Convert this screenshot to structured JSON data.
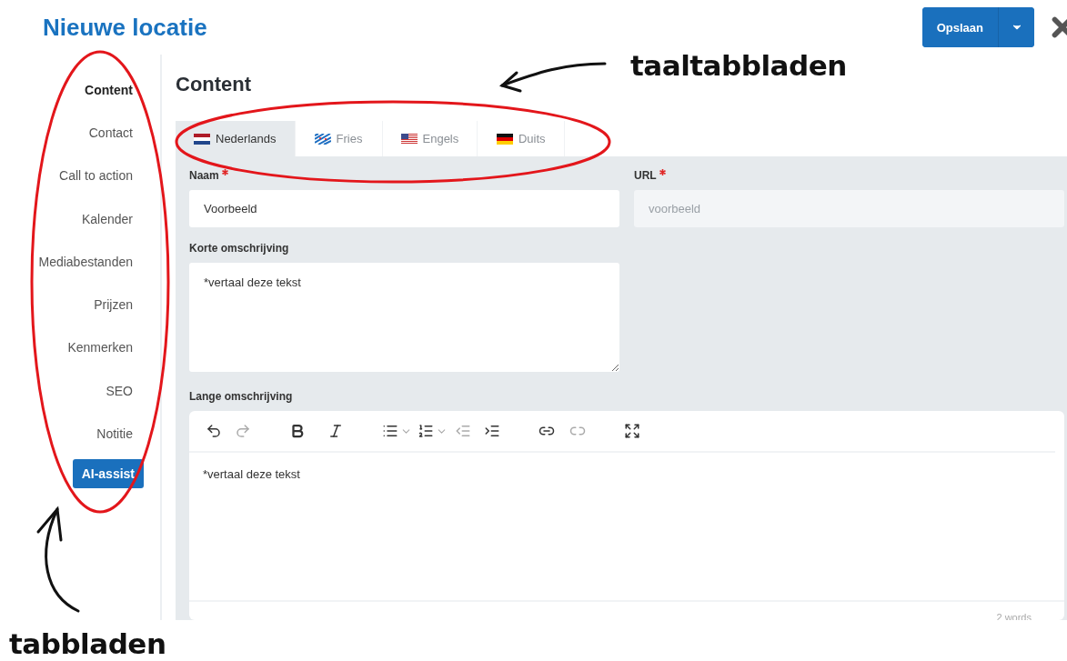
{
  "title": "Nieuwe locatie",
  "save_button": {
    "label": "Opslaan"
  },
  "sidebar": {
    "items": [
      {
        "label": "Content",
        "selected": true
      },
      {
        "label": "Contact",
        "selected": false
      },
      {
        "label": "Call to action",
        "selected": false
      },
      {
        "label": "Kalender",
        "selected": false
      },
      {
        "label": "Mediabestanden",
        "selected": false
      },
      {
        "label": "Prijzen",
        "selected": false
      },
      {
        "label": "Kenmerken",
        "selected": false
      },
      {
        "label": "SEO",
        "selected": false
      },
      {
        "label": "Notitie",
        "selected": false
      }
    ],
    "ai_button": "AI-assist"
  },
  "section_title": "Content",
  "language_tabs": [
    {
      "label": "Nederlands",
      "kind": "nl",
      "selected": true
    },
    {
      "label": "Fries",
      "kind": "fy",
      "selected": false
    },
    {
      "label": "Engels",
      "kind": "us",
      "selected": false
    },
    {
      "label": "Duits",
      "kind": "de",
      "selected": false
    }
  ],
  "fields": {
    "name": {
      "label": "Naam",
      "required": true,
      "value": "Voorbeeld",
      "disabled": false
    },
    "url": {
      "label": "URL",
      "required": true,
      "value": "voorbeeld",
      "disabled": true
    },
    "short_description": {
      "label": "Korte omschrijving",
      "value": "*vertaal deze tekst"
    },
    "long_description": {
      "label": "Lange omschrijving",
      "value": "*vertaal deze tekst",
      "word_count": "2 words"
    }
  },
  "annotations": [
    {
      "text": "taaltabbladen",
      "kind": "tabs"
    },
    {
      "text": "tabbladen",
      "kind": "sidebar"
    }
  ]
}
